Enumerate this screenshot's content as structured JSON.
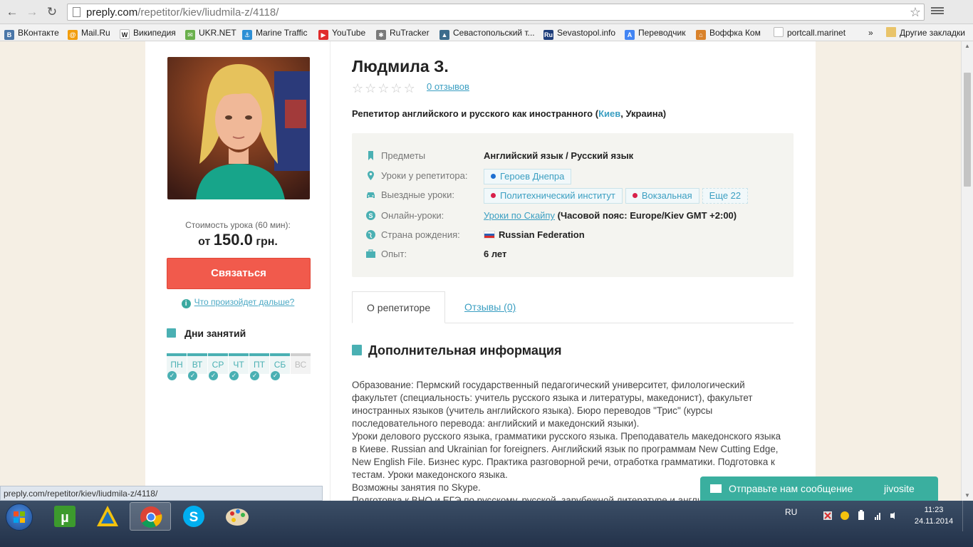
{
  "browser": {
    "url_host": "preply.com",
    "url_path": "/repetitor/kiev/liudmila-z/4118/",
    "bookmarks": [
      {
        "label": "ВКонтакте",
        "icon": "vk-icon",
        "color": "#4a76a8",
        "glyph": "В"
      },
      {
        "label": "Mail.Ru",
        "icon": "mailru-icon",
        "color": "#f29d0c",
        "glyph": "@"
      },
      {
        "label": "Википедия",
        "icon": "wikipedia-icon",
        "color": "#ffffff",
        "glyph": "W"
      },
      {
        "label": "UKR.NET",
        "icon": "ukrnet-icon",
        "color": "#6ab04c",
        "glyph": "✉"
      },
      {
        "label": "Marine Traffic",
        "icon": "marinetraffic-icon",
        "color": "#2d8fd5",
        "glyph": "⚓"
      },
      {
        "label": "YouTube",
        "icon": "youtube-icon",
        "color": "#e02b2b",
        "glyph": "▶"
      },
      {
        "label": "RuTracker",
        "icon": "rutracker-icon",
        "color": "#7a7a7a",
        "glyph": "✱"
      },
      {
        "label": "Севастопольский т...",
        "icon": "sevastopol-icon",
        "color": "#3c6c8c",
        "glyph": "▲"
      },
      {
        "label": "Sevastopol.info",
        "icon": "sevastopolinfo-icon",
        "color": "#1d3d7a",
        "glyph": "Ru"
      },
      {
        "label": "Переводчик",
        "icon": "translator-icon",
        "color": "#4285f4",
        "glyph": "A"
      },
      {
        "label": "Воффка Ком",
        "icon": "home-icon",
        "color": "#d9822b",
        "glyph": "⌂"
      },
      {
        "label": "portcall.marinet",
        "icon": "page-icon",
        "color": "#ffffff",
        "glyph": ""
      }
    ],
    "overflow": "»",
    "other_bookmarks": "Другие закладки",
    "status_url": "preply.com/repetitor/kiev/liudmila-z/4118/"
  },
  "profile": {
    "name": "Людмила З.",
    "reviews_link": "0 отзывов",
    "rating_stars": 0,
    "headline_prefix": "Репетитор английского и русского как иностранного (",
    "headline_city": "Киев",
    "headline_suffix": ", Украина)",
    "price_label": "Стоимость урока (60 мин):",
    "price_prefix": "от",
    "price_value": "150.0",
    "price_currency": "грн.",
    "contact_button": "Связаться",
    "what_next": "Что произойдет дальше?",
    "days_title": "Дни занятий",
    "days": [
      {
        "label": "ПН",
        "available": true
      },
      {
        "label": "ВТ",
        "available": true
      },
      {
        "label": "СР",
        "available": true
      },
      {
        "label": "ЧТ",
        "available": true
      },
      {
        "label": "ПТ",
        "available": true
      },
      {
        "label": "СБ",
        "available": true
      },
      {
        "label": "ВС",
        "available": false
      }
    ]
  },
  "info": {
    "subjects_label": "Предметы",
    "subjects_value": "Английский язык / Русский язык",
    "at_tutor_label": "Уроки у репетитора:",
    "at_tutor_tag": "Героев Днепра",
    "travel_label": "Выездные уроки:",
    "travel_tags": [
      "Политехнический институт",
      "Вокзальная"
    ],
    "travel_more": "Еще 22",
    "online_label": "Онлайн-уроки:",
    "online_link": "Уроки по Скайпу",
    "online_timezone": "(Часовой пояс: Europe/Kiev GMT +2:00)",
    "country_label": "Страна рождения:",
    "country_value": "Russian Federation",
    "experience_label": "Опыт:",
    "experience_value": "6 лет"
  },
  "tabs": {
    "about": "О репетиторе",
    "reviews": "Отзывы (0)"
  },
  "about": {
    "section_title": "Дополнительная информация",
    "p1": "Образование: Пермский государственный педагогический университет, филологический факультет (специальность: учитель русского языка и литературы, македонист), факультет иностранных языков (учитель английского языка). Бюро переводов \"Трис\" (курсы последовательного перевода: английский и македонский языки).",
    "p2": "Уроки делового русского языка, грамматики русского языка. Преподаватель македонского языка в Киеве. Russian and Ukrainian for foreigners. Английский язык по программам New Cutting Edge, New English File. Бизнес курс. Практика разговорной речи, отработка грамматики. Подготовка к тестам. Уроки македонского языка.",
    "p3": "Возможны занятия по Skype.",
    "p4": "Подготовка к ВНО и ЕГЭ по русскому, русской, зарубежной литературе и английскому"
  },
  "chat": {
    "message": "Отправьте нам сообщение",
    "brand": "jivosite"
  },
  "taskbar": {
    "lang": "RU",
    "time": "11:23",
    "date": "24.11.2014"
  },
  "colors": {
    "accent": "#4ab0b3",
    "link": "#3b9fc2",
    "contact_button": "#f15a4c",
    "page_bg": "#f5efe4"
  }
}
